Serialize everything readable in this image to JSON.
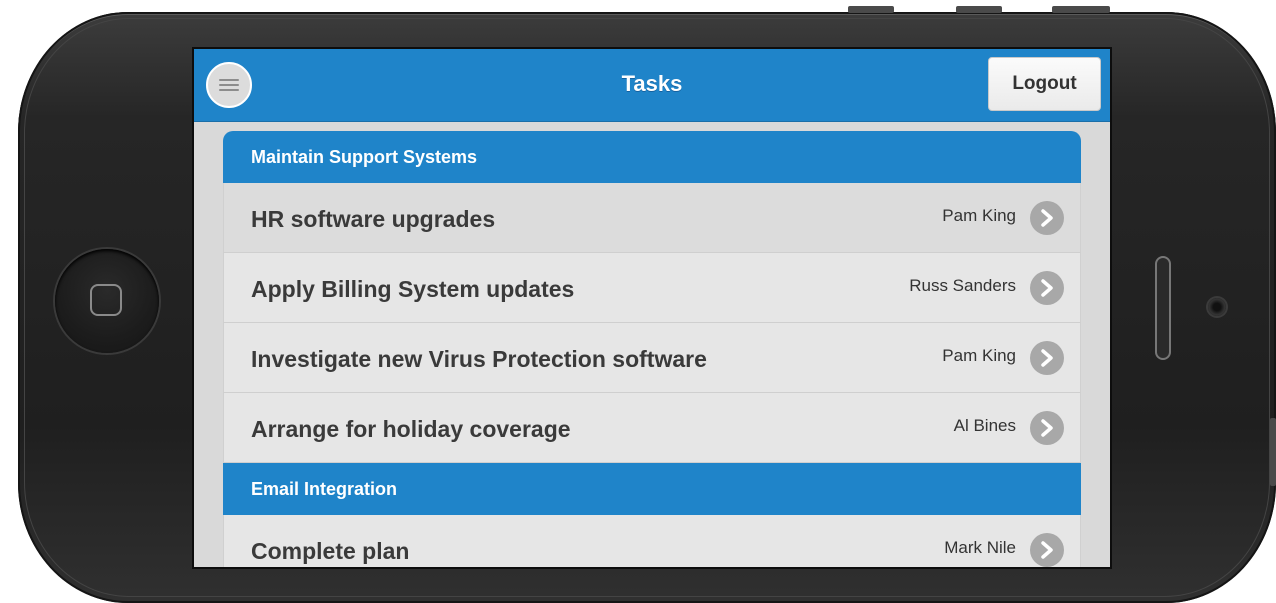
{
  "app": {
    "title": "Tasks",
    "logout_label": "Logout",
    "menu_icon": "menu-icon",
    "accent_color": "#1f84c9"
  },
  "groups": [
    {
      "title": "Maintain Support Systems",
      "tasks": [
        {
          "title": "HR software upgrades",
          "owner": "Pam King"
        },
        {
          "title": "Apply Billing System updates",
          "owner": "Russ Sanders"
        },
        {
          "title": "Investigate new Virus Protection software",
          "owner": "Pam King"
        },
        {
          "title": "Arrange for holiday coverage",
          "owner": "Al Bines"
        }
      ]
    },
    {
      "title": "Email Integration",
      "tasks": [
        {
          "title": "Complete plan",
          "owner": "Mark Nile"
        }
      ]
    }
  ],
  "row_arrow_icon": "chevron-right-icon"
}
